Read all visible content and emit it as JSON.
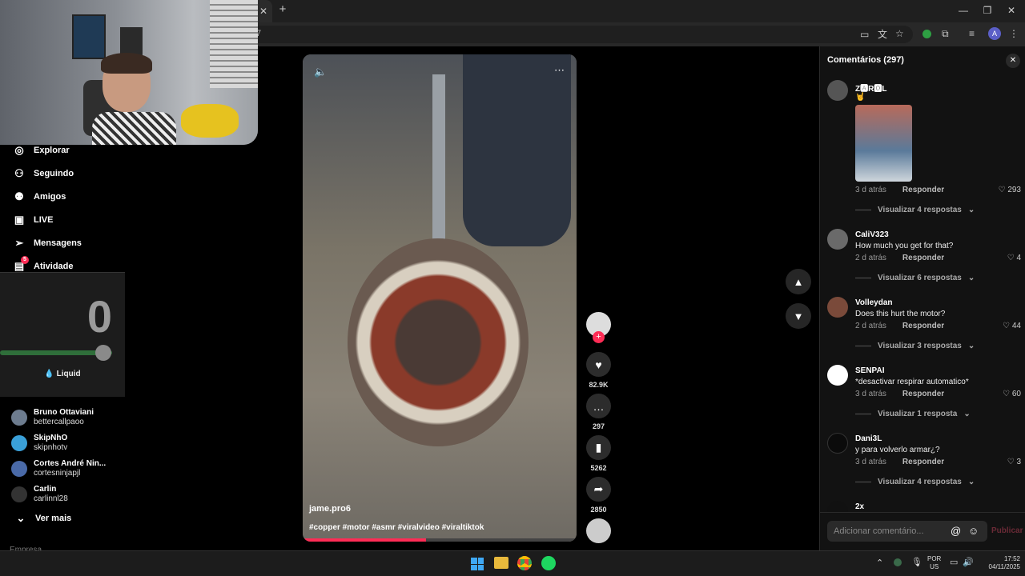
{
  "browser": {
    "new_tab": "+",
    "close_tab": "✕",
    "url_fragment": "7"
  },
  "sidebar": {
    "nav": [
      {
        "label": "Explorar",
        "icon": "compass-icon"
      },
      {
        "label": "Seguindo",
        "icon": "user-follow-icon"
      },
      {
        "label": "Amigos",
        "icon": "friends-icon"
      },
      {
        "label": "LIVE",
        "icon": "live-icon"
      },
      {
        "label": "Mensagens",
        "icon": "send-icon"
      },
      {
        "label": "Atividade",
        "icon": "inbox-icon",
        "badge": "5"
      }
    ],
    "following": [
      {
        "name": "Bruno Ottaviani",
        "user": "bettercallpaoo"
      },
      {
        "name": "SkipNhO",
        "user": "skipnhotv"
      },
      {
        "name": "Cortes André Nin...",
        "user": "cortesninjapjl"
      },
      {
        "name": "Carlin",
        "user": "carlinnl28"
      }
    ],
    "see_more": "Ver mais",
    "footer_cut": "Empresa"
  },
  "liquid_widget": {
    "value": "0",
    "label": "Liquid",
    "slider_fraction": 0.85
  },
  "video": {
    "author": "jame.pro6",
    "caption": "#copper #motor #asmr #viralvideo #viraltiktok",
    "progress_fraction": 0.45
  },
  "actions": {
    "likes": "82.9K",
    "comments": "297",
    "saves": "5262",
    "shares": "2850"
  },
  "comments_panel": {
    "title": "Comentários (297)",
    "reply_label": "Responder",
    "items": [
      {
        "user": "Z🅰R🅾L",
        "text": "🤘",
        "time": "3 d atrás",
        "likes": "293",
        "replies": "Visualizar 4 respostas",
        "has_image": true
      },
      {
        "user": "CaliV323",
        "text": "How much you get for that?",
        "time": "2 d atrás",
        "likes": "4",
        "replies": "Visualizar 6 respostas"
      },
      {
        "user": "Volleydan",
        "text": "Does this hurt the motor?",
        "time": "2 d atrás",
        "likes": "44",
        "replies": "Visualizar 3 respostas"
      },
      {
        "user": "SENPAI",
        "text": "*desactivar respirar automatico*",
        "time": "3 d atrás",
        "likes": "60",
        "replies": "Visualizar 1 resposta"
      },
      {
        "user": "Dani3L",
        "text": "y para volverlo armar¿?",
        "time": "3 d atrás",
        "likes": "3",
        "replies": "Visualizar 4 respostas"
      },
      {
        "user": "2x",
        "text": "",
        "time": "",
        "likes": "",
        "replies": ""
      }
    ],
    "input_placeholder": "Adicionar comentário...",
    "publish": "Publicar"
  },
  "taskbar": {
    "lang": "POR",
    "region": "US",
    "time": "17:52",
    "date": "04/11/2025"
  }
}
